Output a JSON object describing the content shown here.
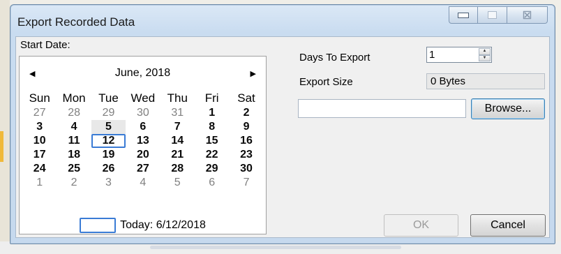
{
  "window": {
    "title": "Export Recorded Data",
    "controls": {
      "minimize": "minimize",
      "maximize": "maximize",
      "close_glyph": "☒"
    }
  },
  "start_date": {
    "label": "Start Date:",
    "calendar": {
      "prev_glyph": "◀",
      "next_glyph": "▶",
      "month_label": "June, 2018",
      "weekdays": [
        "Sun",
        "Mon",
        "Tue",
        "Wed",
        "Thu",
        "Fri",
        "Sat"
      ],
      "weeks": [
        [
          {
            "d": "27",
            "o": true
          },
          {
            "d": "28",
            "o": true
          },
          {
            "d": "29",
            "o": true
          },
          {
            "d": "30",
            "o": true
          },
          {
            "d": "31",
            "o": true
          },
          {
            "d": "1"
          },
          {
            "d": "2"
          }
        ],
        [
          {
            "d": "3"
          },
          {
            "d": "4"
          },
          {
            "d": "5",
            "sel": true
          },
          {
            "d": "6"
          },
          {
            "d": "7"
          },
          {
            "d": "8"
          },
          {
            "d": "9"
          }
        ],
        [
          {
            "d": "10"
          },
          {
            "d": "11"
          },
          {
            "d": "12",
            "today": true
          },
          {
            "d": "13"
          },
          {
            "d": "14"
          },
          {
            "d": "15"
          },
          {
            "d": "16"
          }
        ],
        [
          {
            "d": "17"
          },
          {
            "d": "18"
          },
          {
            "d": "19"
          },
          {
            "d": "20"
          },
          {
            "d": "21"
          },
          {
            "d": "22"
          },
          {
            "d": "23"
          }
        ],
        [
          {
            "d": "24"
          },
          {
            "d": "25"
          },
          {
            "d": "26"
          },
          {
            "d": "27"
          },
          {
            "d": "28"
          },
          {
            "d": "29"
          },
          {
            "d": "30"
          }
        ],
        [
          {
            "d": "1",
            "o": true
          },
          {
            "d": "2",
            "o": true
          },
          {
            "d": "3",
            "o": true
          },
          {
            "d": "4",
            "o": true
          },
          {
            "d": "5",
            "o": true
          },
          {
            "d": "6",
            "o": true
          },
          {
            "d": "7",
            "o": true
          }
        ]
      ],
      "today_label": "Today: 6/12/2018"
    }
  },
  "days_to_export": {
    "label": "Days To Export",
    "value": "1"
  },
  "export_size": {
    "label": "Export Size",
    "value": "0 Bytes"
  },
  "path": {
    "value": ""
  },
  "buttons": {
    "browse": "Browse...",
    "ok": "OK",
    "cancel": "Cancel"
  },
  "colors": {
    "today_outline": "#3a7bd5",
    "titlebar": "#c9dcf0",
    "backdrop_stripe": "#f0b93a"
  }
}
